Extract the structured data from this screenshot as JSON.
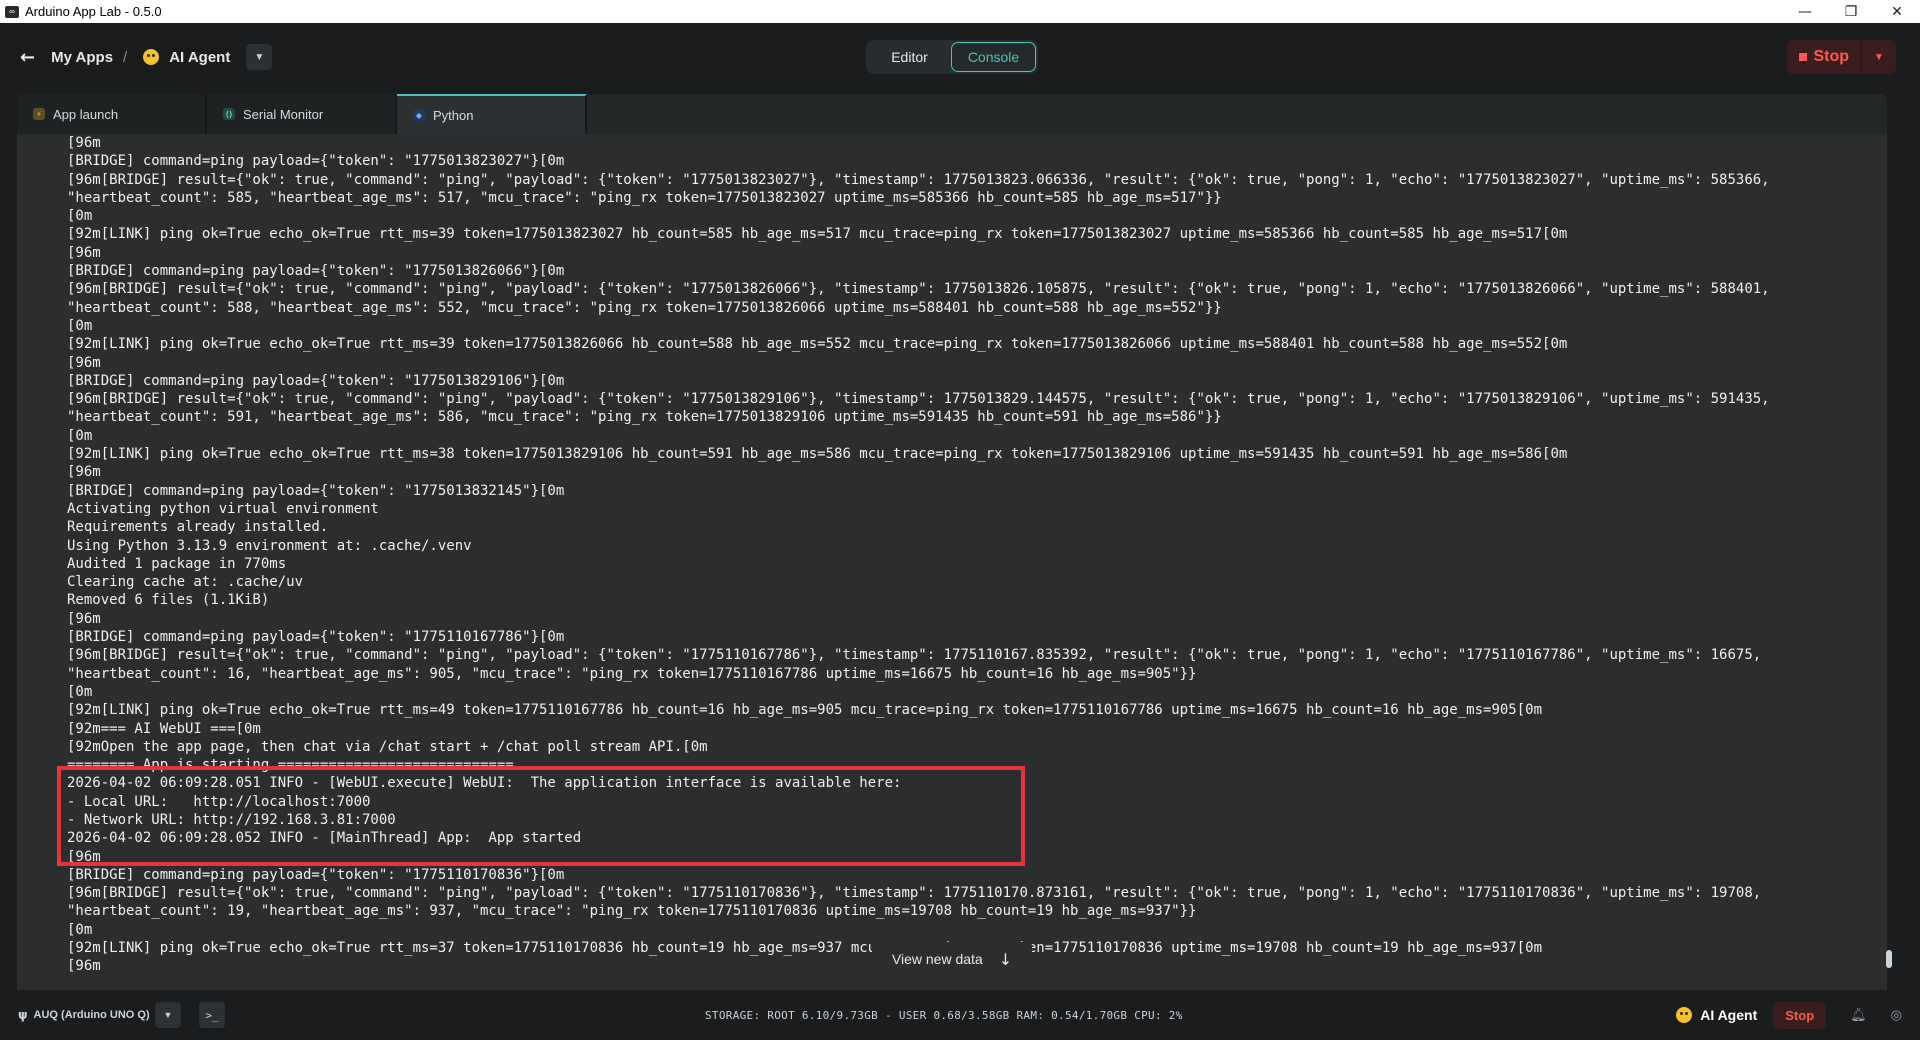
{
  "window": {
    "title": "Arduino App Lab - 0.5.0",
    "controls": [
      "—",
      "❐",
      "✕"
    ]
  },
  "header": {
    "breadcrumb_root": "My Apps",
    "separator": "/",
    "app_name": "AI Agent",
    "modes": [
      {
        "label": "Editor",
        "active": false
      },
      {
        "label": "Console",
        "active": true
      }
    ],
    "stop_label": "Stop"
  },
  "tabs": [
    {
      "label": "App launch",
      "icon": "rocket-icon",
      "active": false
    },
    {
      "label": "Serial Monitor",
      "icon": "serial-icon",
      "active": false
    },
    {
      "label": "Python",
      "icon": "python-icon",
      "active": true
    }
  ],
  "console": {
    "lines": [
      "[96m",
      "[BRIDGE] command=ping payload={\"token\": \"1775013823027\"}[0m",
      "[96m[BRIDGE] result={\"ok\": true, \"command\": \"ping\", \"payload\": {\"token\": \"1775013823027\"}, \"timestamp\": 1775013823.066336, \"result\": {\"ok\": true, \"pong\": 1, \"echo\": \"1775013823027\", \"uptime_ms\": 585366,",
      "\"heartbeat_count\": 585, \"heartbeat_age_ms\": 517, \"mcu_trace\": \"ping_rx token=1775013823027 uptime_ms=585366 hb_count=585 hb_age_ms=517\"}}",
      "[0m",
      "[92m[LINK] ping ok=True echo_ok=True rtt_ms=39 token=1775013823027 hb_count=585 hb_age_ms=517 mcu_trace=ping_rx token=1775013823027 uptime_ms=585366 hb_count=585 hb_age_ms=517[0m",
      "[96m",
      "[BRIDGE] command=ping payload={\"token\": \"1775013826066\"}[0m",
      "[96m[BRIDGE] result={\"ok\": true, \"command\": \"ping\", \"payload\": {\"token\": \"1775013826066\"}, \"timestamp\": 1775013826.105875, \"result\": {\"ok\": true, \"pong\": 1, \"echo\": \"1775013826066\", \"uptime_ms\": 588401,",
      "\"heartbeat_count\": 588, \"heartbeat_age_ms\": 552, \"mcu_trace\": \"ping_rx token=1775013826066 uptime_ms=588401 hb_count=588 hb_age_ms=552\"}}",
      "[0m",
      "[92m[LINK] ping ok=True echo_ok=True rtt_ms=39 token=1775013826066 hb_count=588 hb_age_ms=552 mcu_trace=ping_rx token=1775013826066 uptime_ms=588401 hb_count=588 hb_age_ms=552[0m",
      "[96m",
      "[BRIDGE] command=ping payload={\"token\": \"1775013829106\"}[0m",
      "[96m[BRIDGE] result={\"ok\": true, \"command\": \"ping\", \"payload\": {\"token\": \"1775013829106\"}, \"timestamp\": 1775013829.144575, \"result\": {\"ok\": true, \"pong\": 1, \"echo\": \"1775013829106\", \"uptime_ms\": 591435,",
      "\"heartbeat_count\": 591, \"heartbeat_age_ms\": 586, \"mcu_trace\": \"ping_rx token=1775013829106 uptime_ms=591435 hb_count=591 hb_age_ms=586\"}}",
      "[0m",
      "[92m[LINK] ping ok=True echo_ok=True rtt_ms=38 token=1775013829106 hb_count=591 hb_age_ms=586 mcu_trace=ping_rx token=1775013829106 uptime_ms=591435 hb_count=591 hb_age_ms=586[0m",
      "[96m",
      "[BRIDGE] command=ping payload={\"token\": \"1775013832145\"}[0m",
      "Activating python virtual environment",
      "Requirements already installed.",
      "Using Python 3.13.9 environment at: .cache/.venv",
      "Audited 1 package in 770ms",
      "Clearing cache at: .cache/uv",
      "Removed 6 files (1.1KiB)",
      "[96m",
      "[BRIDGE] command=ping payload={\"token\": \"1775110167786\"}[0m",
      "[96m[BRIDGE] result={\"ok\": true, \"command\": \"ping\", \"payload\": {\"token\": \"1775110167786\"}, \"timestamp\": 1775110167.835392, \"result\": {\"ok\": true, \"pong\": 1, \"echo\": \"1775110167786\", \"uptime_ms\": 16675,",
      "\"heartbeat_count\": 16, \"heartbeat_age_ms\": 905, \"mcu_trace\": \"ping_rx token=1775110167786 uptime_ms=16675 hb_count=16 hb_age_ms=905\"}}",
      "[0m",
      "[92m[LINK] ping ok=True echo_ok=True rtt_ms=49 token=1775110167786 hb_count=16 hb_age_ms=905 mcu_trace=ping_rx token=1775110167786 uptime_ms=16675 hb_count=16 hb_age_ms=905[0m",
      "[92m=== AI WebUI ===[0m",
      "[92mOpen the app page, then chat via /chat start + /chat poll stream API.[0m",
      "======== App is starting ============================",
      "2026-04-02 06:09:28.051 INFO - [WebUI.execute] WebUI:  The application interface is available here:",
      "- Local URL:   http://localhost:7000",
      "- Network URL: http://192.168.3.81:7000",
      "2026-04-02 06:09:28.052 INFO - [MainThread] App:  App started",
      "[96m",
      "[BRIDGE] command=ping payload={\"token\": \"1775110170836\"}[0m",
      "[96m[BRIDGE] result={\"ok\": true, \"command\": \"ping\", \"payload\": {\"token\": \"1775110170836\"}, \"timestamp\": 1775110170.873161, \"result\": {\"ok\": true, \"pong\": 1, \"echo\": \"1775110170836\", \"uptime_ms\": 19708,",
      "\"heartbeat_count\": 19, \"heartbeat_age_ms\": 937, \"mcu_trace\": \"ping_rx token=1775110170836 uptime_ms=19708 hb_count=19 hb_age_ms=937\"}}",
      "[0m",
      "[92m[LINK] ping ok=True echo_ok=True rtt_ms=37 token=1775110170836 hb_count=19 hb_age_ms=937 mcu_trace=ping_rx token=1775110170836 uptime_ms=19708 hb_count=19 hb_age_ms=937[0m",
      "[96m"
    ],
    "view_new_data": "View new data",
    "highlight_color": "#e8333a"
  },
  "statusbar": {
    "board": "AUQ (Arduino UNO Q)",
    "terminal_glyph": ">_",
    "stats": "STORAGE: ROOT 6.10/9.73GB - USER 0.68/3.58GB  RAM: 0.54/1.70GB  CPU: 2%",
    "agent_name": "AI Agent",
    "stop_label": "Stop"
  },
  "colors": {
    "accent": "#4fc1b9",
    "stop": "#ff5a52",
    "background": "#1a1c1d"
  }
}
